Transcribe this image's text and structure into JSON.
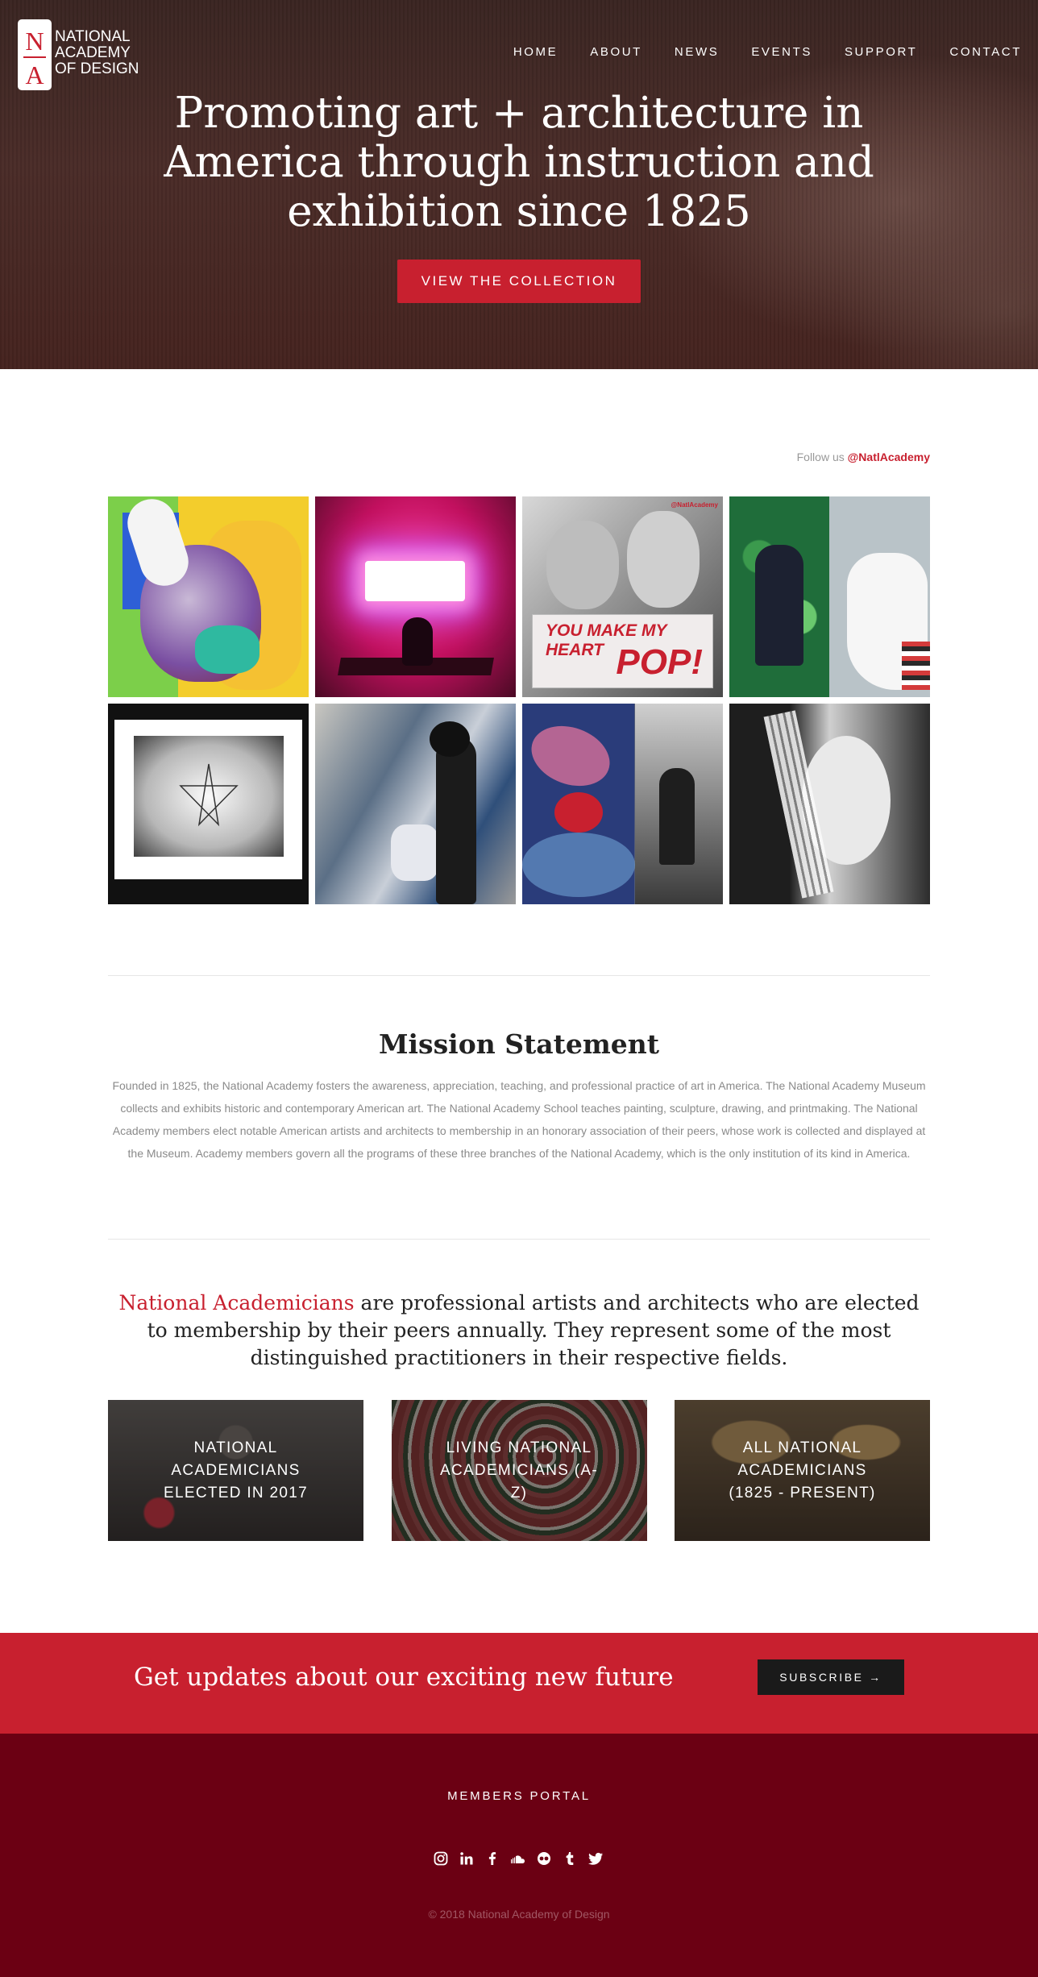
{
  "header": {
    "logo": {
      "monogram_top": "N",
      "monogram_bottom": "A",
      "lines": [
        "NATIONAL",
        "ACADEMY",
        "OF DESIGN"
      ]
    },
    "nav": [
      "HOME",
      "ABOUT",
      "NEWS",
      "EVENTS",
      "SUPPORT",
      "CONTACT"
    ]
  },
  "hero": {
    "title": "Promoting art + architecture in America through instruction and exhibition since 1825",
    "cta_label": "VIEW THE COLLECTION"
  },
  "instagram": {
    "follow_prefix": "Follow us ",
    "handle": "@NatlAcademy",
    "tile3_tag": "@NatlAcademy",
    "tile3_line1": "YOU MAKE MY HEART",
    "tile3_line2": "POP!"
  },
  "mission": {
    "title": "Mission Statement",
    "text": "Founded in 1825, the National Academy fosters the awareness, appreciation, teaching, and professional practice of art in America. The National Academy Museum collects and exhibits historic and contemporary American art. The National Academy School teaches painting, sculpture, drawing, and printmaking. The National Academy members elect notable American artists and architects to membership in an honorary association of their peers, whose work is collected and displayed at the Museum. Academy members govern all the programs of these three branches of the National Academy, which is the only institution of its kind in America."
  },
  "academicians": {
    "highlight": "National Academicians",
    "text": " are professional artists and architects who are elected to membership by their peers annually. They represent some of the most distinguished practitioners in their respective fields.",
    "cards": [
      {
        "label": "NATIONAL ACADEMICIANS ELECTED IN 2017"
      },
      {
        "label": "LIVING NATIONAL ACADEMICIANS (A-Z)"
      },
      {
        "label": "ALL NATIONAL ACADEMICIANS (1825 - PRESENT)"
      }
    ]
  },
  "subscribe": {
    "text": "Get updates about our exciting new future",
    "button": "SUBSCRIBE →"
  },
  "footer": {
    "members_portal": "MEMBERS PORTAL",
    "socials": [
      "instagram-icon",
      "linkedin-icon",
      "facebook-icon",
      "soundcloud-icon",
      "flickr-icon",
      "tumblr-icon",
      "twitter-icon"
    ],
    "copyright": "© 2018 National Academy of Design"
  },
  "colors": {
    "brand_red": "#c8202f",
    "footer_maroon": "#6b0013",
    "dark_button": "#1a1a1a"
  }
}
